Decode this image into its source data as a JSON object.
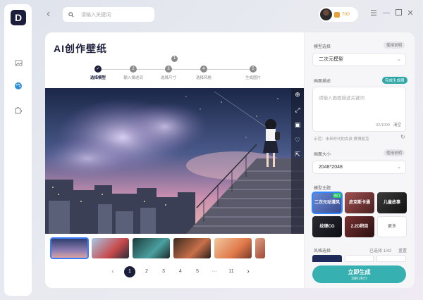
{
  "search": {
    "placeholder": "请输入关键词"
  },
  "user": {
    "points": "700"
  },
  "page": {
    "title": "AI创作壁纸"
  },
  "steps": [
    {
      "label": "选择模型",
      "active": true
    },
    {
      "label": "输入描述词",
      "num": "2"
    },
    {
      "label": "选择尺寸",
      "num": "3"
    },
    {
      "label": "选择风格",
      "num": "4"
    },
    {
      "label": "生成图片",
      "num": "5"
    }
  ],
  "step_marker": "1",
  "pager": {
    "pages": [
      "1",
      "2",
      "3",
      "4",
      "5",
      "···",
      "11"
    ],
    "current": "1",
    "prev": "‹",
    "next": "›"
  },
  "panel": {
    "model": {
      "label": "模型选择",
      "value": "二次元模型",
      "tag": "使用说明"
    },
    "prompt": {
      "label": "画面描述",
      "tag": "完成生成器",
      "placeholder": "请输入画面描述关键词",
      "count": "32/1000",
      "clear": "清空"
    },
    "example": "示范：未来时代的女孩 赛博朋克",
    "size": {
      "label": "画面大小",
      "value": "2048*2048",
      "tag": "使用说明"
    },
    "theme": {
      "label": "模型主题"
    },
    "themes": [
      {
        "label": "二次元动漫风",
        "hot": "热门",
        "color": "#5a74c8"
      },
      {
        "label": "皮克斯卡通",
        "color": "#7a3a3a"
      },
      {
        "label": "儿童故事",
        "color": "#2c2c2c"
      },
      {
        "label": "纹理CG",
        "color": "#1e1e24"
      },
      {
        "label": "2.2D积目",
        "color": "#4a2020"
      },
      {
        "label": "更多",
        "color": "#ffffff"
      }
    ],
    "style": {
      "label": "风格选择",
      "selected": "已选择 1/42",
      "reset": "重置"
    },
    "generate": {
      "label": "立即生成",
      "sub": "消耗1积分"
    }
  }
}
